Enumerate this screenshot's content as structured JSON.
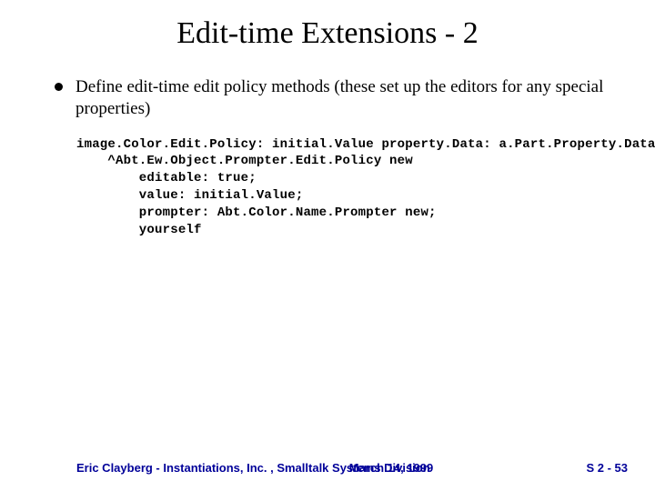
{
  "title": "Edit-time Extensions - 2",
  "bullet": "Define edit-time edit policy methods (these set up the editors for any special properties)",
  "code": "image.Color.Edit.Policy: initial.Value property.Data: a.Part.Property.Data\n    ^Abt.Ew.Object.Prompter.Edit.Policy new\n        editable: true;\n        value: initial.Value;\n        prompter: Abt.Color.Name.Prompter new;\n        yourself",
  "footer": {
    "left": "Eric Clayberg - Instantiations, Inc. , Smalltalk Systems Division",
    "center": "March 14, 1999",
    "right": "S 2 - 53"
  }
}
